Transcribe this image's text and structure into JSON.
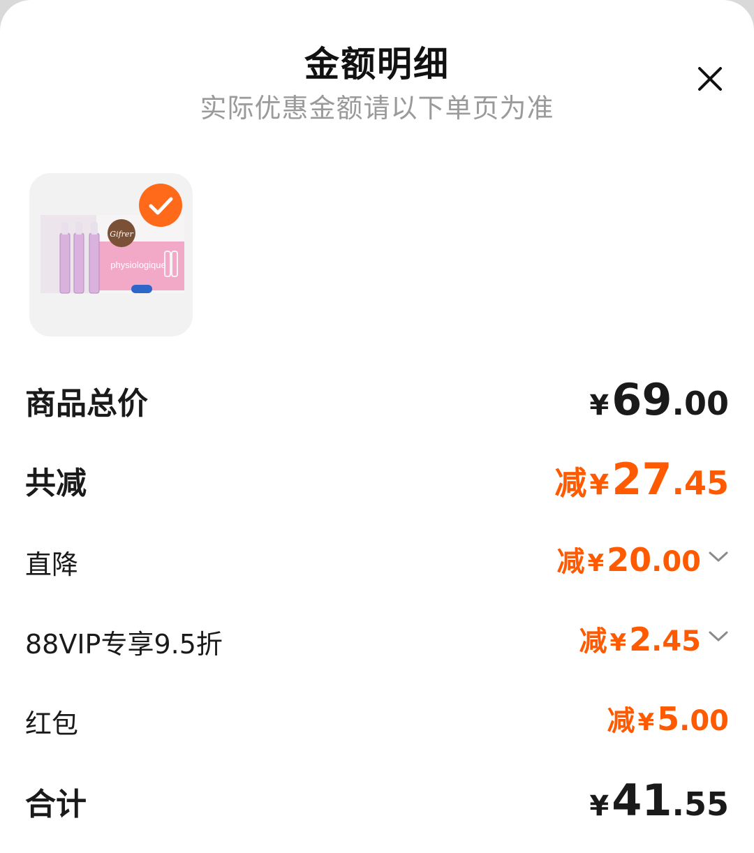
{
  "header": {
    "title": "金额明细",
    "subtitle": "实际优惠金额请以下单页为准",
    "close_icon": "close-icon"
  },
  "product": {
    "image_icon": "product-thumbnail",
    "brand_text": "Gifrer",
    "product_text": "physiologique",
    "selected_icon": "check-circle-icon",
    "selected": true
  },
  "rows": {
    "subtotal": {
      "label": "商品总价",
      "currency": "¥",
      "int": "69",
      "dec": ".00"
    },
    "total_discount": {
      "label": "共减",
      "prefix": "减",
      "currency": "¥",
      "int": "27",
      "dec": ".45"
    },
    "direct_discount": {
      "label": "直降",
      "prefix": "减",
      "currency": "¥",
      "int": "20",
      "dec": ".00",
      "expand_icon": "chevron-down-icon"
    },
    "vip_discount": {
      "label": "88VIP专享9.5折",
      "prefix": "减",
      "currency": "¥",
      "int": "2",
      "dec": ".45",
      "expand_icon": "chevron-down-icon"
    },
    "red_packet": {
      "label": "红包",
      "prefix": "减",
      "currency": "¥",
      "int": "5",
      "dec": ".00"
    },
    "total": {
      "label": "合计",
      "currency": "¥",
      "int": "41",
      "dec": ".55"
    }
  },
  "colors": {
    "accent": "#ff5a00",
    "check_badge": "#ff6a1a",
    "text_primary": "#1a1a1a",
    "text_secondary": "#9a9a9a"
  }
}
